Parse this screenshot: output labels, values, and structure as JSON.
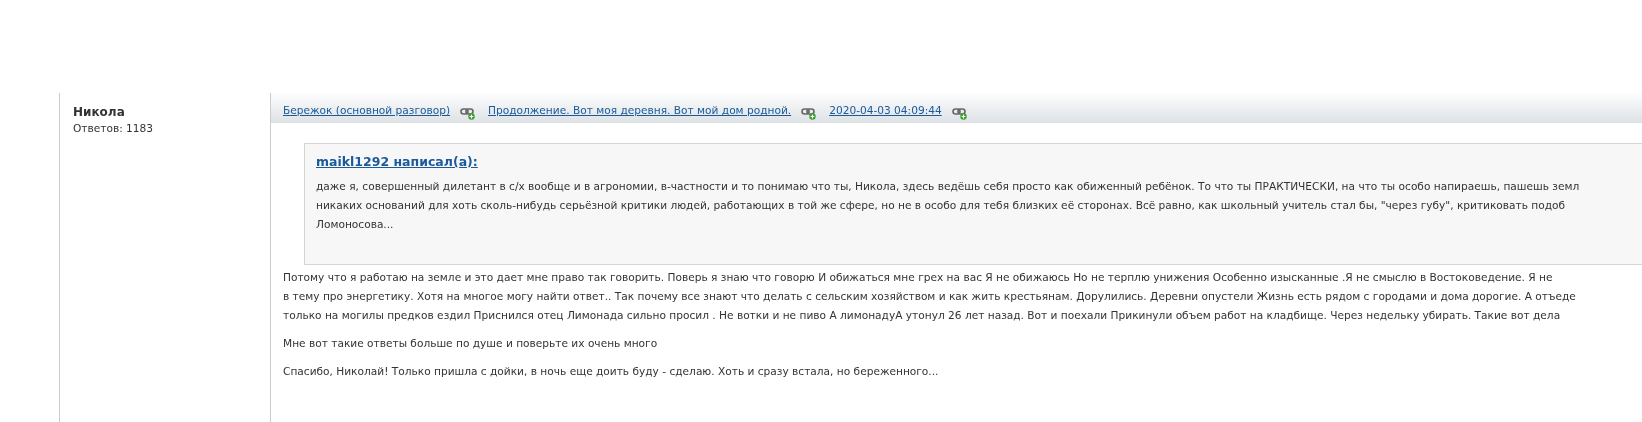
{
  "author": {
    "name": "Никола",
    "replies": "Ответов: 1183"
  },
  "breadcrumbs": [
    {
      "label": "Бережок (основной разговор)"
    },
    {
      "label": "Продолжение. Вот моя деревня. Вот мой дом родной."
    },
    {
      "label": "2020-04-03 04:09:44"
    }
  ],
  "quote": {
    "author": "maikl1292 написал(а):",
    "lines": [
      "даже я, совершенный дилетант в с/х вообще и в агрономии, в-частности и то понимаю что ты, Никола, здесь ведёшь себя просто как обиженный ребёнок. То что ты ПРАКТИЧЕСКИ, на что ты особо напираешь, пашешь земл",
      "никаких оснований для хоть сколь-нибудь серьёзной критики людей, работающих в той же сфере, но не в особо для тебя близких её сторонах. Всё равно, как школьный учитель стал бы, \"через губу\", критиковать подоб",
      "Ломоносова..."
    ]
  },
  "paragraphs": [
    {
      "lines": [
        "Потому что я работаю на земле и это дает мне право так говорить. Поверь я знаю что говорю  И обижаться мне грех на вас Я не обижаюсь Но не терплю унижения  Особенно изысканные  .Я не смыслю в  Востоковедение. Я не",
        "в тему про энергетику. Хотя на многое могу найти ответ.. Так почему все знают что делать  с сельским хозяйством и как жить  крестьянам. Дорулились. Деревни опустели Жизнь есть рядом с городами и дома дорогие. А отъеде",
        "только на могилы  предков ездил Приснился отец Лимонада сильно просил . Не вотки и не пиво А лимонадуА  утонул 26 лет назад. Вот и поехали Прикинули объем работ на кладбище. Через недельку убирать. Такие вот дела"
      ]
    },
    {
      "lines": [
        "Мне вот такие ответы  больше по душе и поверьте их очень много"
      ]
    },
    {
      "lines": [
        "Спасибо, Николай! Только пришла с дойки, в ночь еще доить буду - сделаю. Хоть и сразу встала, но береженного..."
      ]
    }
  ]
}
